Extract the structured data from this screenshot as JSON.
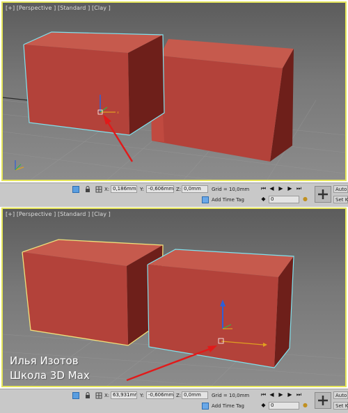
{
  "colors": {
    "viewport_border": "#e6e65a",
    "box_front": "#b3423a",
    "box_side": "#6e1f1a",
    "box_top": "#c65a4d",
    "selection_cyan": "#7fe3ef",
    "selection_yellow": "#f0e07a",
    "arrow_red": "#e11a1a",
    "statusbar_bg": "#c8c8c8"
  },
  "top": {
    "viewport_label": "[+] [Perspective ] [Standard ] [Clay ]",
    "status": {
      "x_label": "X:",
      "x_value": "0,186mm",
      "y_label": "Y:",
      "y_value": "-0,606mm",
      "z_label": "Z:",
      "z_value": "0,0mm",
      "grid": "Grid = 10,0mm",
      "add_time_tag": "Add Time Tag",
      "frame_value": "0",
      "auto_key": "Auto Ke",
      "set_key": "Set Ke"
    }
  },
  "bottom": {
    "viewport_label": "[+] [Perspective ] [Standard ] [Clay ]",
    "caption_line1": "Илья Изотов",
    "caption_line2": "Школа 3D Max",
    "status": {
      "x_label": "X:",
      "x_value": "63,931mm",
      "y_label": "Y:",
      "y_value": "-0,606mm",
      "z_label": "Z:",
      "z_value": "0,0mm",
      "grid": "Grid = 10,0mm",
      "add_time_tag": "Add Time Tag",
      "frame_value": "0",
      "auto_key": "Auto Ke",
      "set_key": "Set Ke"
    }
  },
  "icons": [
    "select-icon",
    "lock-icon",
    "absolute-mode-icon",
    "time-tag-icon",
    "go-start-icon",
    "prev-frame-icon",
    "play-icon",
    "next-frame-icon",
    "go-end-icon",
    "key-mode-icon",
    "key-filters-icon",
    "add-key-icon"
  ]
}
